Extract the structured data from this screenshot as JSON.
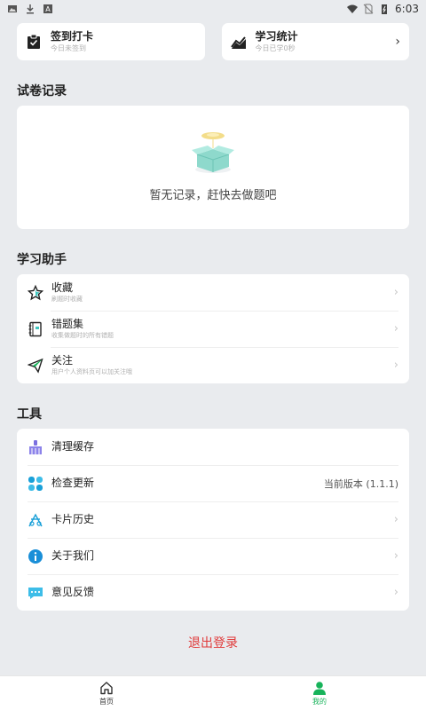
{
  "status_bar": {
    "time": "6:03"
  },
  "top_cards": [
    {
      "title": "签到打卡",
      "subtitle": "今日未签到",
      "icon": "clipboard-check-icon"
    },
    {
      "title": "学习统计",
      "subtitle": "今日已学0秒",
      "icon": "trend-chart-icon"
    }
  ],
  "exam_section": {
    "title": "试卷记录",
    "empty_message": "暂无记录，赶快去做题吧"
  },
  "helper_section": {
    "title": "学习助手",
    "items": [
      {
        "title": "收藏",
        "subtitle": "刷题时收藏",
        "icon": "star-icon"
      },
      {
        "title": "错题集",
        "subtitle": "收集做题时的所有错题",
        "icon": "notebook-icon"
      },
      {
        "title": "关注",
        "subtitle": "用户个人资料页可以加关注哦",
        "icon": "paper-plane-icon"
      }
    ]
  },
  "tools_section": {
    "title": "工具",
    "items": [
      {
        "title": "清理缓存",
        "value": "",
        "icon": "broom-icon"
      },
      {
        "title": "检查更新",
        "value": "当前版本 (1.1.1)",
        "icon": "update-icon"
      },
      {
        "title": "卡片历史",
        "value": "",
        "icon": "card-history-icon"
      },
      {
        "title": "关于我们",
        "value": "",
        "icon": "info-icon"
      },
      {
        "title": "意见反馈",
        "value": "",
        "icon": "feedback-icon"
      }
    ]
  },
  "logout_label": "退出登录",
  "tabbar": {
    "tabs": [
      {
        "label": "首页",
        "icon": "home-icon"
      },
      {
        "label": "我的",
        "icon": "profile-icon"
      }
    ]
  },
  "colors": {
    "accent": "#17b35a",
    "danger": "#e03a3a",
    "background": "#e9ebee"
  }
}
